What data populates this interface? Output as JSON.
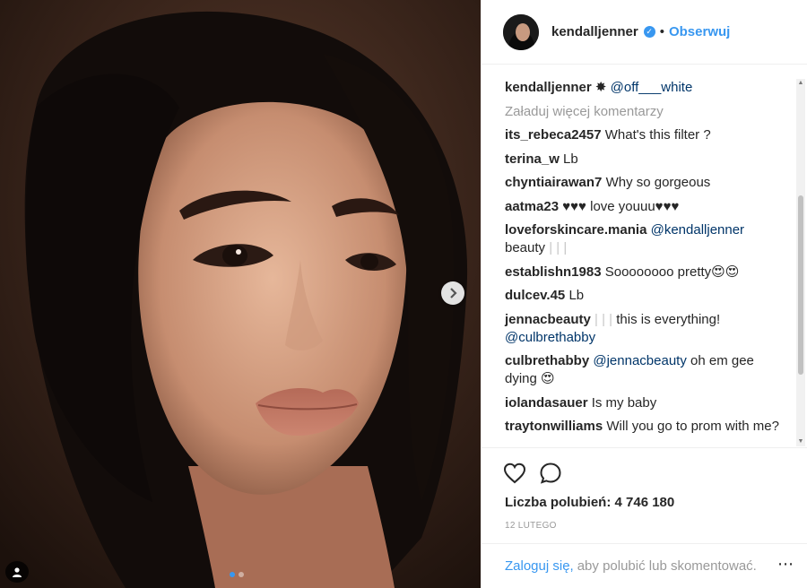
{
  "header": {
    "username": "kendalljenner",
    "separator": "•",
    "follow_label": "Obserwuj"
  },
  "caption": {
    "username": "kendalljenner",
    "text": "✸",
    "mention": "@off___white"
  },
  "load_more_label": "Załaduj więcej komentarzy",
  "comments": [
    {
      "username": "its_rebeca2457",
      "text": "What's this filter ?"
    },
    {
      "username": "terina_w",
      "text": "Lb"
    },
    {
      "username": "chyntiairawan7",
      "text": "Why so gorgeous"
    },
    {
      "username": "aatma23",
      "text": "♥♥♥ love youuu♥♥♥"
    },
    {
      "username": "loveforskincare.mania",
      "mention": "@kendalljenner",
      "text": "beauty",
      "faint": "| | |"
    },
    {
      "username": "establishn1983",
      "text": "Soooooooo pretty😍😍"
    },
    {
      "username": "dulcev.45",
      "text": "Lb"
    },
    {
      "username": "jennacbeauty",
      "faint": "| | |",
      "text": "this is everything!",
      "mention": "@culbrethabby"
    },
    {
      "username": "culbrethabby",
      "mention": "@jennacbeauty",
      "text": "oh em gee dying 😍"
    },
    {
      "username": "iolandasauer",
      "text": "Is my baby"
    },
    {
      "username": "traytonwilliams",
      "text": "Will you go to prom with me?"
    }
  ],
  "likes_label": "Liczba polubień: 4 746 180",
  "date_label": "12 LUTEGO",
  "login_bar": {
    "link_label": "Zaloguj się,",
    "text": "aby polubić lub skomentować.",
    "more_label": "⋯"
  },
  "icons": [
    "heart-icon",
    "comment-icon",
    "chevron-right-icon",
    "user-tag-icon",
    "verified-icon",
    "more-icon"
  ],
  "colors": {
    "accent": "#3897f0",
    "mention": "#003569",
    "muted": "#999999",
    "border": "#efefef"
  }
}
